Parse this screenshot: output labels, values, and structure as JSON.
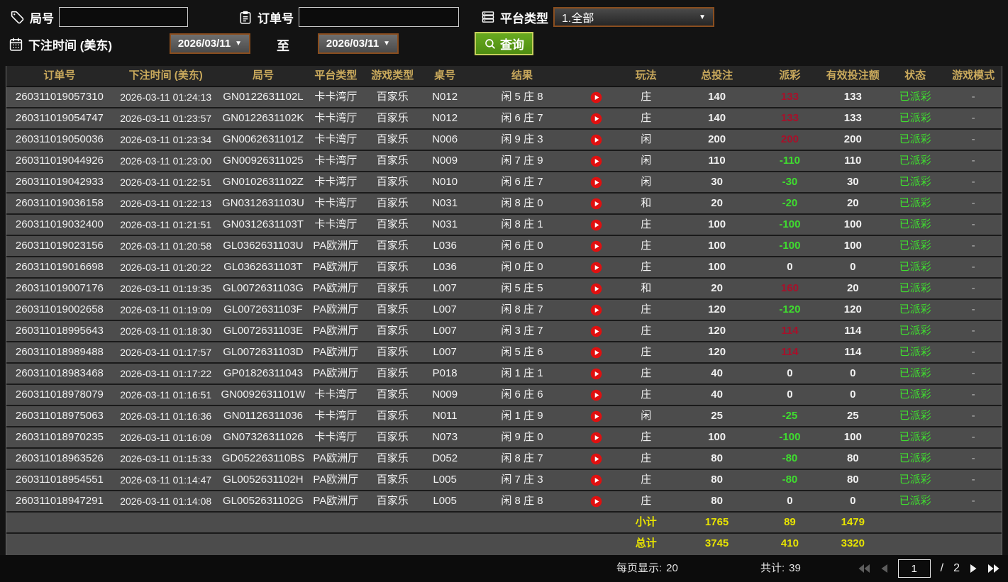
{
  "filters": {
    "round_label": "局号",
    "round_value": "",
    "order_label": "订单号",
    "order_value": "",
    "platform_label": "平台类型",
    "platform_value": "1.全部",
    "bet_time_label": "下注时间 (美东)",
    "date_from": "2026/03/11",
    "to_label": "至",
    "date_to": "2026/03/11",
    "search_label": "查询"
  },
  "icons": {
    "dropdown_arrow": "▼"
  },
  "colors": {
    "header_gold": "#c9a95c",
    "payout_win": "#a8102a",
    "payout_loss": "#3fdd2f",
    "status_green": "#3fdd2f",
    "summary_yellow": "#e8e400",
    "play_icon": "#e01010",
    "search_button_green": "#55941a"
  },
  "table": {
    "columns": [
      "订单号",
      "下注时间 (美东)",
      "局号",
      "平台类型",
      "游戏类型",
      "桌号",
      "结果",
      "玩法",
      "总投注",
      "派彩",
      "有效投注额",
      "状态",
      "游戏模式"
    ],
    "rows": [
      {
        "order_no": "260311019057310",
        "bet_time": "2026-03-11 01:24:13",
        "round_no": "GN0122631102L",
        "platform": "卡卡湾厅",
        "game_type": "百家乐",
        "table_no": "N012",
        "result": "闲 5 庄 8",
        "play": "庄",
        "total_bet": "140",
        "payout": "133",
        "payout_type": "win",
        "valid_bet": "133",
        "status": "已派彩",
        "game_mode": "-"
      },
      {
        "order_no": "260311019054747",
        "bet_time": "2026-03-11 01:23:57",
        "round_no": "GN0122631102K",
        "platform": "卡卡湾厅",
        "game_type": "百家乐",
        "table_no": "N012",
        "result": "闲 6 庄 7",
        "play": "庄",
        "total_bet": "140",
        "payout": "133",
        "payout_type": "win",
        "valid_bet": "133",
        "status": "已派彩",
        "game_mode": "-"
      },
      {
        "order_no": "260311019050036",
        "bet_time": "2026-03-11 01:23:34",
        "round_no": "GN0062631101Z",
        "platform": "卡卡湾厅",
        "game_type": "百家乐",
        "table_no": "N006",
        "result": "闲 9 庄 3",
        "play": "闲",
        "total_bet": "200",
        "payout": "200",
        "payout_type": "win",
        "valid_bet": "200",
        "status": "已派彩",
        "game_mode": "-"
      },
      {
        "order_no": "260311019044926",
        "bet_time": "2026-03-11 01:23:00",
        "round_no": "GN00926311025",
        "platform": "卡卡湾厅",
        "game_type": "百家乐",
        "table_no": "N009",
        "result": "闲 7 庄 9",
        "play": "闲",
        "total_bet": "110",
        "payout": "-110",
        "payout_type": "loss",
        "valid_bet": "110",
        "status": "已派彩",
        "game_mode": "-"
      },
      {
        "order_no": "260311019042933",
        "bet_time": "2026-03-11 01:22:51",
        "round_no": "GN0102631102Z",
        "platform": "卡卡湾厅",
        "game_type": "百家乐",
        "table_no": "N010",
        "result": "闲 6 庄 7",
        "play": "闲",
        "total_bet": "30",
        "payout": "-30",
        "payout_type": "loss",
        "valid_bet": "30",
        "status": "已派彩",
        "game_mode": "-"
      },
      {
        "order_no": "260311019036158",
        "bet_time": "2026-03-11 01:22:13",
        "round_no": "GN0312631103U",
        "platform": "卡卡湾厅",
        "game_type": "百家乐",
        "table_no": "N031",
        "result": "闲 8 庄 0",
        "play": "和",
        "total_bet": "20",
        "payout": "-20",
        "payout_type": "loss",
        "valid_bet": "20",
        "status": "已派彩",
        "game_mode": "-"
      },
      {
        "order_no": "260311019032400",
        "bet_time": "2026-03-11 01:21:51",
        "round_no": "GN0312631103T",
        "platform": "卡卡湾厅",
        "game_type": "百家乐",
        "table_no": "N031",
        "result": "闲 8 庄 1",
        "play": "庄",
        "total_bet": "100",
        "payout": "-100",
        "payout_type": "loss",
        "valid_bet": "100",
        "status": "已派彩",
        "game_mode": "-"
      },
      {
        "order_no": "260311019023156",
        "bet_time": "2026-03-11 01:20:58",
        "round_no": "GL0362631103U",
        "platform": "PA欧洲厅",
        "game_type": "百家乐",
        "table_no": "L036",
        "result": "闲 6 庄 0",
        "play": "庄",
        "total_bet": "100",
        "payout": "-100",
        "payout_type": "loss",
        "valid_bet": "100",
        "status": "已派彩",
        "game_mode": "-"
      },
      {
        "order_no": "260311019016698",
        "bet_time": "2026-03-11 01:20:22",
        "round_no": "GL0362631103T",
        "platform": "PA欧洲厅",
        "game_type": "百家乐",
        "table_no": "L036",
        "result": "闲 0 庄 0",
        "play": "庄",
        "total_bet": "100",
        "payout": "0",
        "payout_type": "zero",
        "valid_bet": "0",
        "status": "已派彩",
        "game_mode": "-"
      },
      {
        "order_no": "260311019007176",
        "bet_time": "2026-03-11 01:19:35",
        "round_no": "GL0072631103G",
        "platform": "PA欧洲厅",
        "game_type": "百家乐",
        "table_no": "L007",
        "result": "闲 5 庄 5",
        "play": "和",
        "total_bet": "20",
        "payout": "160",
        "payout_type": "win",
        "valid_bet": "20",
        "status": "已派彩",
        "game_mode": "-"
      },
      {
        "order_no": "260311019002658",
        "bet_time": "2026-03-11 01:19:09",
        "round_no": "GL0072631103F",
        "platform": "PA欧洲厅",
        "game_type": "百家乐",
        "table_no": "L007",
        "result": "闲 8 庄 7",
        "play": "庄",
        "total_bet": "120",
        "payout": "-120",
        "payout_type": "loss",
        "valid_bet": "120",
        "status": "已派彩",
        "game_mode": "-"
      },
      {
        "order_no": "260311018995643",
        "bet_time": "2026-03-11 01:18:30",
        "round_no": "GL0072631103E",
        "platform": "PA欧洲厅",
        "game_type": "百家乐",
        "table_no": "L007",
        "result": "闲 3 庄 7",
        "play": "庄",
        "total_bet": "120",
        "payout": "114",
        "payout_type": "win",
        "valid_bet": "114",
        "status": "已派彩",
        "game_mode": "-"
      },
      {
        "order_no": "260311018989488",
        "bet_time": "2026-03-11 01:17:57",
        "round_no": "GL0072631103D",
        "platform": "PA欧洲厅",
        "game_type": "百家乐",
        "table_no": "L007",
        "result": "闲 5 庄 6",
        "play": "庄",
        "total_bet": "120",
        "payout": "114",
        "payout_type": "win",
        "valid_bet": "114",
        "status": "已派彩",
        "game_mode": "-"
      },
      {
        "order_no": "260311018983468",
        "bet_time": "2026-03-11 01:17:22",
        "round_no": "GP01826311043",
        "platform": "PA欧洲厅",
        "game_type": "百家乐",
        "table_no": "P018",
        "result": "闲 1 庄 1",
        "play": "庄",
        "total_bet": "40",
        "payout": "0",
        "payout_type": "zero",
        "valid_bet": "0",
        "status": "已派彩",
        "game_mode": "-"
      },
      {
        "order_no": "260311018978079",
        "bet_time": "2026-03-11 01:16:51",
        "round_no": "GN0092631101W",
        "platform": "卡卡湾厅",
        "game_type": "百家乐",
        "table_no": "N009",
        "result": "闲 6 庄 6",
        "play": "庄",
        "total_bet": "40",
        "payout": "0",
        "payout_type": "zero",
        "valid_bet": "0",
        "status": "已派彩",
        "game_mode": "-"
      },
      {
        "order_no": "260311018975063",
        "bet_time": "2026-03-11 01:16:36",
        "round_no": "GN01126311036",
        "platform": "卡卡湾厅",
        "game_type": "百家乐",
        "table_no": "N011",
        "result": "闲 1 庄 9",
        "play": "闲",
        "total_bet": "25",
        "payout": "-25",
        "payout_type": "loss",
        "valid_bet": "25",
        "status": "已派彩",
        "game_mode": "-"
      },
      {
        "order_no": "260311018970235",
        "bet_time": "2026-03-11 01:16:09",
        "round_no": "GN07326311026",
        "platform": "卡卡湾厅",
        "game_type": "百家乐",
        "table_no": "N073",
        "result": "闲 9 庄 0",
        "play": "庄",
        "total_bet": "100",
        "payout": "-100",
        "payout_type": "loss",
        "valid_bet": "100",
        "status": "已派彩",
        "game_mode": "-"
      },
      {
        "order_no": "260311018963526",
        "bet_time": "2026-03-11 01:15:33",
        "round_no": "GD052263110BS",
        "platform": "PA欧洲厅",
        "game_type": "百家乐",
        "table_no": "D052",
        "result": "闲 8 庄 7",
        "play": "庄",
        "total_bet": "80",
        "payout": "-80",
        "payout_type": "loss",
        "valid_bet": "80",
        "status": "已派彩",
        "game_mode": "-"
      },
      {
        "order_no": "260311018954551",
        "bet_time": "2026-03-11 01:14:47",
        "round_no": "GL0052631102H",
        "platform": "PA欧洲厅",
        "game_type": "百家乐",
        "table_no": "L005",
        "result": "闲 7 庄 3",
        "play": "庄",
        "total_bet": "80",
        "payout": "-80",
        "payout_type": "loss",
        "valid_bet": "80",
        "status": "已派彩",
        "game_mode": "-"
      },
      {
        "order_no": "260311018947291",
        "bet_time": "2026-03-11 01:14:08",
        "round_no": "GL0052631102G",
        "platform": "PA欧洲厅",
        "game_type": "百家乐",
        "table_no": "L005",
        "result": "闲 8 庄 8",
        "play": "庄",
        "total_bet": "80",
        "payout": "0",
        "payout_type": "zero",
        "valid_bet": "0",
        "status": "已派彩",
        "game_mode": "-"
      }
    ],
    "subtotal": {
      "label": "小计",
      "total_bet": "1765",
      "payout": "89",
      "valid_bet": "1479"
    },
    "total": {
      "label": "总计",
      "total_bet": "3745",
      "payout": "410",
      "valid_bet": "3320"
    }
  },
  "footer": {
    "per_page_label": "每页显示:",
    "per_page": "20",
    "total_label": "共计:",
    "total_count": "39",
    "current_page": "1",
    "page_sep": "/",
    "total_pages": "2"
  }
}
